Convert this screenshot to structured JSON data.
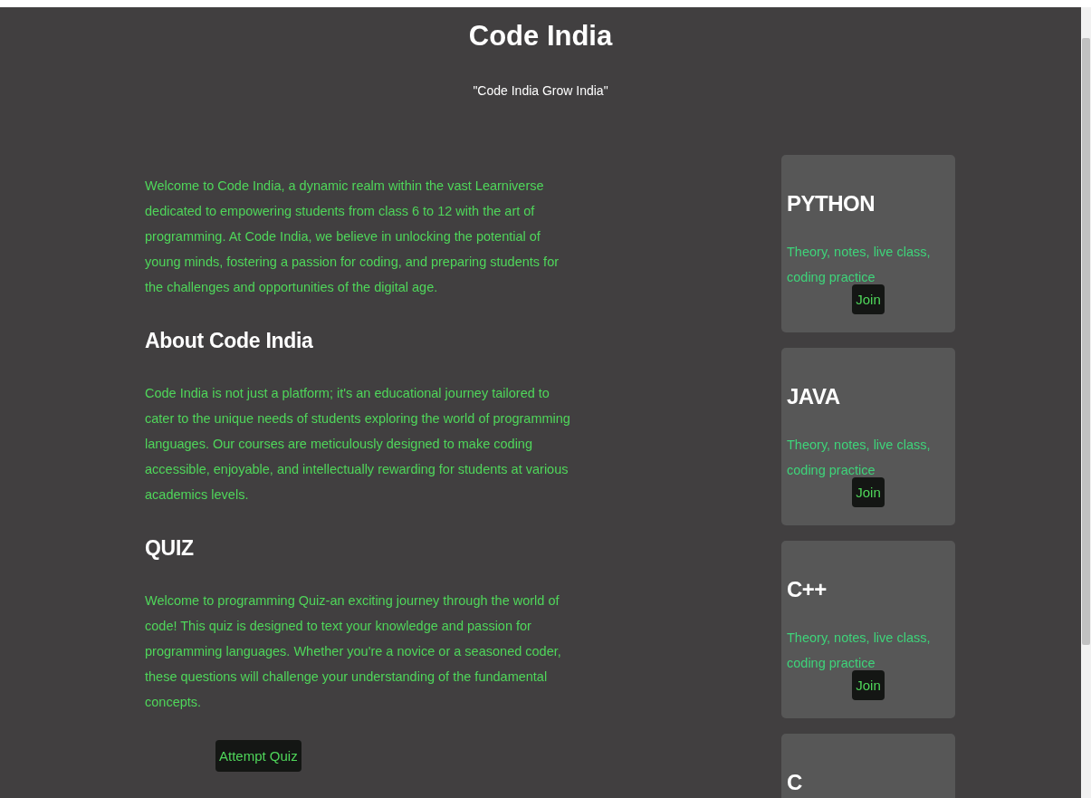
{
  "header": {
    "title": "Code India",
    "tagline": "\"Code India Grow India\""
  },
  "intro": "Welcome to Code India, a dynamic realm within the vast Learniverse dedicated to empowering students from class 6 to 12 with the art of programming. At Code India, we believe in unlocking the potential of young minds, fostering a passion for coding, and preparing students for the challenges and opportunities of the digital age.",
  "sections": [
    {
      "heading": "About Code India",
      "text": "Code India is not just a platform; it's an educational journey tailored to cater to the unique needs of students exploring the world of programming languages. Our courses are meticulously designed to make coding accessible, enjoyable, and intellectually rewarding for students at various academics levels."
    },
    {
      "heading": "QUIZ",
      "text": "Welcome to programming Quiz-an exciting journey through the world of code! This quiz is designed to text your knowledge and passion for programming languages. Whether you're a novice or a seasoned coder, these questions will challenge your understanding of the fundamental concepts.",
      "button": "Attempt Quiz"
    }
  ],
  "courses": [
    {
      "title": "PYTHON",
      "description": "Theory, notes, live class, coding practice",
      "button": "Join"
    },
    {
      "title": "JAVA",
      "description": "Theory, notes, live class, coding practice",
      "button": "Join"
    },
    {
      "title": "C++",
      "description": "Theory, notes, live class, coding practice",
      "button": "Join"
    },
    {
      "title": "C"
    }
  ]
}
